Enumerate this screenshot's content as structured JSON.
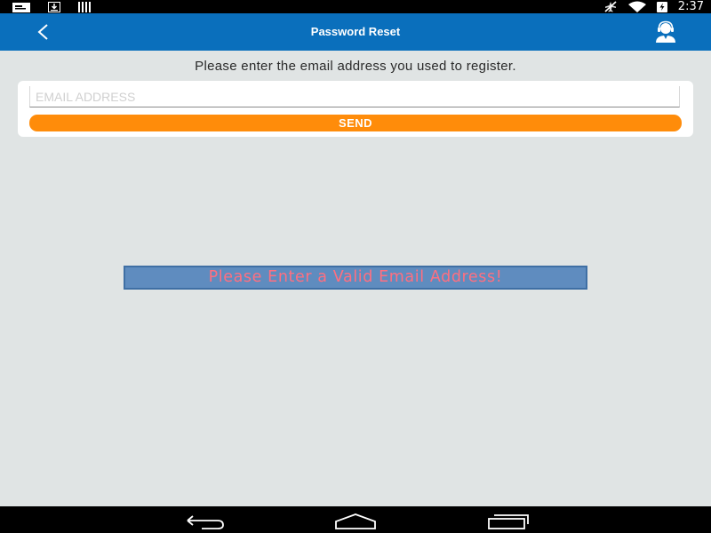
{
  "status_bar": {
    "time": "2:37",
    "left_icons": [
      "message-icon",
      "download-icon",
      "barcode-icon"
    ],
    "right_icons": [
      "airplane-mode-icon",
      "wifi-icon",
      "battery-charging-icon"
    ]
  },
  "app_bar": {
    "title": "Password Reset",
    "back_icon": "chevron-left-icon",
    "support_icon": "customer-support-icon",
    "color": "#0a6fbc"
  },
  "form": {
    "instruction": "Please enter the email address you used to register.",
    "email_value": "",
    "email_placeholder": "EMAIL ADDRESS",
    "send_label": "SEND",
    "send_color": "#ff8c0a"
  },
  "toast": {
    "message": "Please Enter a Valid Email Address!",
    "background": "#5f8cbf",
    "text_color": "#ff6f80"
  },
  "nav_bar": {
    "icons": [
      "back-nav-icon",
      "home-nav-icon",
      "recent-apps-icon"
    ]
  }
}
